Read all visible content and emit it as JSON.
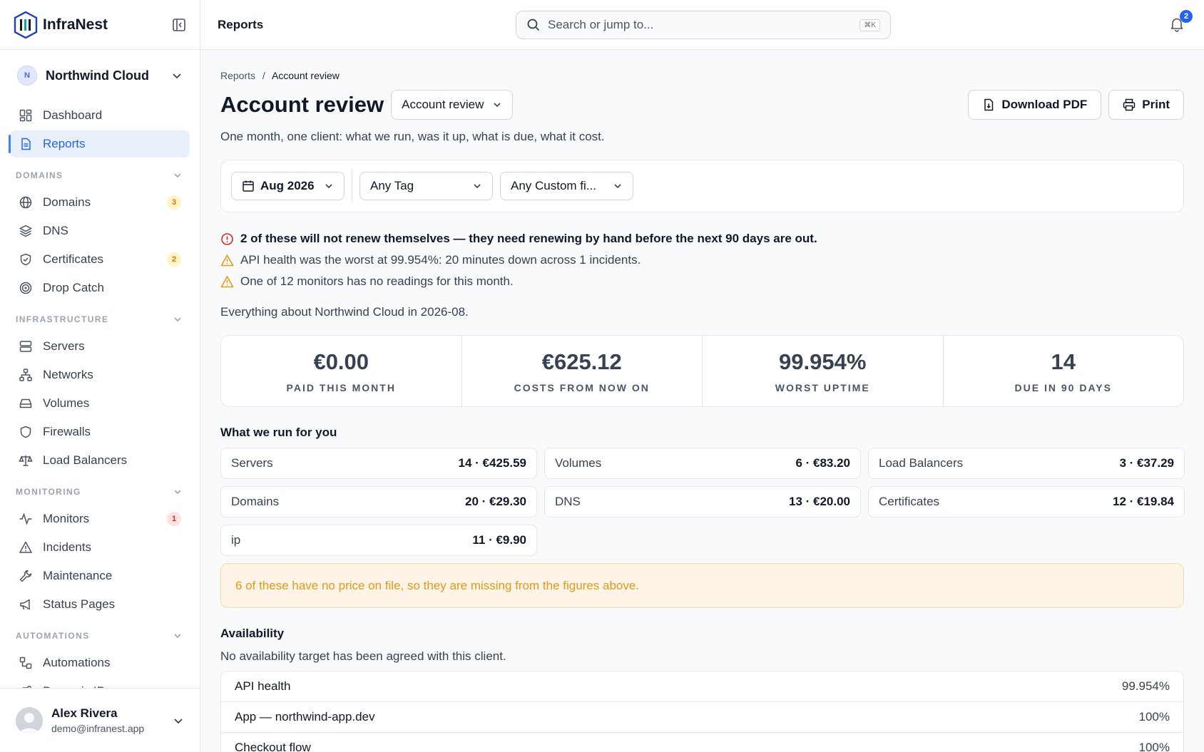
{
  "brand": {
    "name": "InfraNest"
  },
  "org": {
    "initial": "N",
    "name": "Northwind Cloud"
  },
  "nav": {
    "dashboard": "Dashboard",
    "reports": "Reports",
    "sections": {
      "domains": "DOMAINS",
      "infrastructure": "INFRASTRUCTURE",
      "monitoring": "MONITORING",
      "automations": "AUTOMATIONS"
    },
    "domains": {
      "label": "Domains",
      "badge": "3"
    },
    "dns": "DNS",
    "certificates": {
      "label": "Certificates",
      "badge": "2"
    },
    "drop_catch": "Drop Catch",
    "servers": "Servers",
    "networks": "Networks",
    "volumes": "Volumes",
    "firewalls": "Firewalls",
    "load_balancers": "Load Balancers",
    "monitors": {
      "label": "Monitors",
      "badge": "1"
    },
    "incidents": "Incidents",
    "maintenance": "Maintenance",
    "status_pages": "Status Pages",
    "automations": "Automations",
    "dynamic_ips": "Dynamic IPs"
  },
  "user": {
    "name": "Alex Rivera",
    "email": "demo@infranest.app"
  },
  "topbar": {
    "title": "Reports",
    "search_placeholder": "Search or jump to...",
    "shortcut": "⌘K",
    "notifications": "2"
  },
  "breadcrumb": {
    "parent": "Reports",
    "sep": "/",
    "current": "Account review"
  },
  "page": {
    "title": "Account review",
    "report_select": "Account review",
    "download_label": "Download PDF",
    "print_label": "Print",
    "subtitle": "One month, one client: what we run, was it up, what is due, what it cost."
  },
  "filters": {
    "month": "Aug 2026",
    "tag": "Any Tag",
    "custom": "Any Custom fi..."
  },
  "alerts": [
    {
      "kind": "error",
      "text": "2 of these will not renew themselves — they need renewing by hand before the next 90 days are out."
    },
    {
      "kind": "warning",
      "text": "API health was the worst at 99.954%: 20 minutes down across 1 incidents."
    },
    {
      "kind": "warning",
      "text": "One of 12 monitors has no readings for this month."
    }
  ],
  "everything": "Everything about Northwind Cloud in 2026-08.",
  "stats": [
    {
      "value": "€0.00",
      "label": "PAID THIS MONTH"
    },
    {
      "value": "€625.12",
      "label": "COSTS FROM NOW ON"
    },
    {
      "value": "99.954%",
      "label": "WORST UPTIME"
    },
    {
      "value": "14",
      "label": "DUE IN 90 DAYS"
    }
  ],
  "run": {
    "title": "What we run for you",
    "items": [
      {
        "name": "Servers",
        "value": "14 · €425.59"
      },
      {
        "name": "Volumes",
        "value": "6 · €83.20"
      },
      {
        "name": "Load Balancers",
        "value": "3 · €37.29"
      },
      {
        "name": "Domains",
        "value": "20 · €29.30"
      },
      {
        "name": "DNS",
        "value": "13 · €20.00"
      },
      {
        "name": "Certificates",
        "value": "12 · €19.84"
      },
      {
        "name": "ip",
        "value": "11 · €9.90"
      }
    ]
  },
  "no_price_note": "6 of these have no price on file, so they are missing from the figures above.",
  "availability": {
    "title": "Availability",
    "subtitle": "No availability target has been agreed with this client.",
    "rows": [
      {
        "name": "API health",
        "value": "99.954%"
      },
      {
        "name": "App — northwind-app.dev",
        "value": "100%"
      },
      {
        "name": "Checkout flow",
        "value": "100%"
      }
    ]
  }
}
